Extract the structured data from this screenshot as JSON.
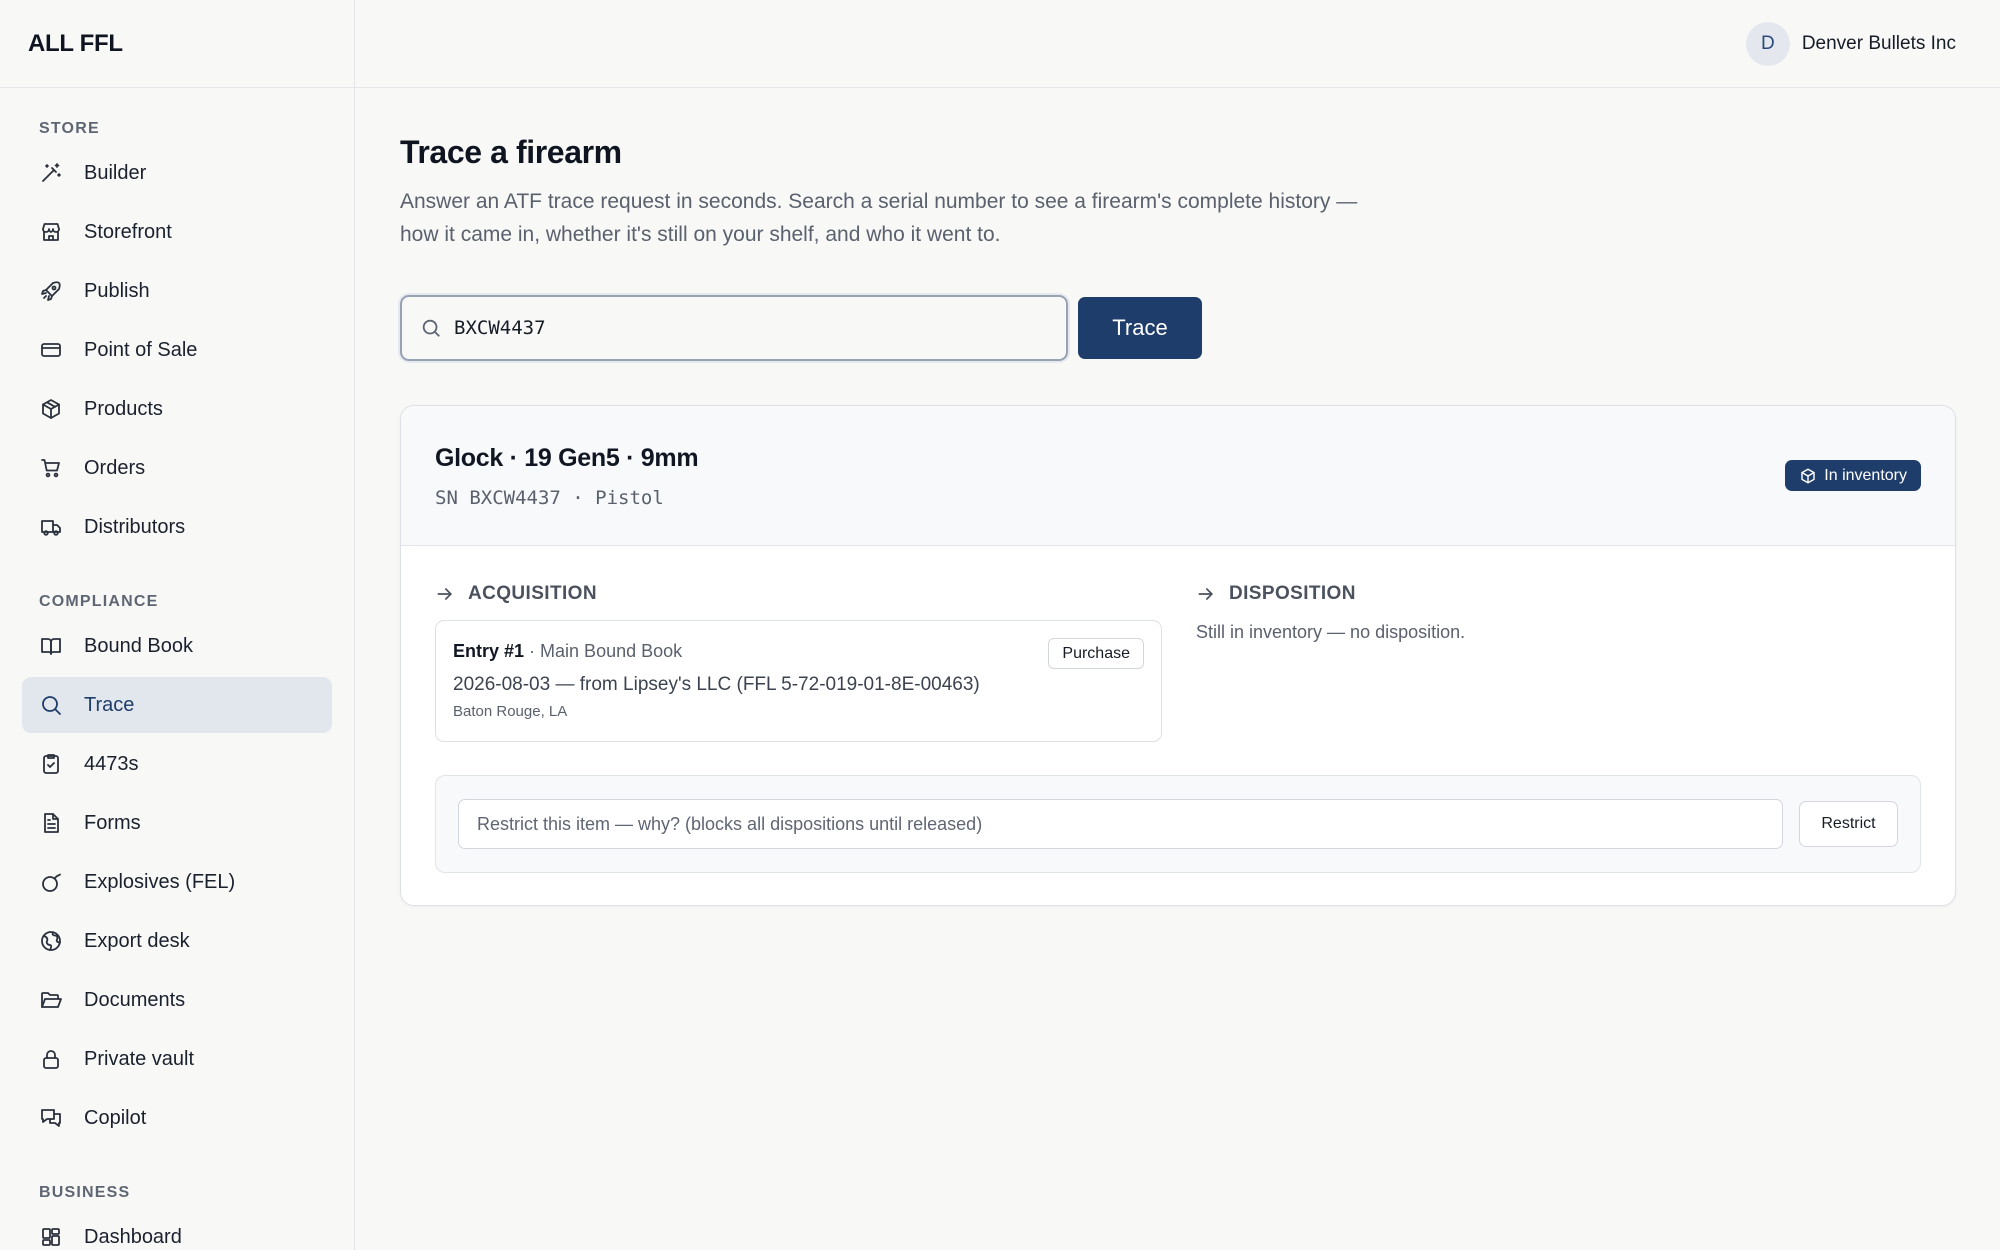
{
  "app": {
    "brand": "ALL FFL"
  },
  "account": {
    "initial": "D",
    "name": "Denver Bullets Inc"
  },
  "sidebar": {
    "sections": [
      {
        "label": "STORE",
        "items": [
          {
            "label": "Builder",
            "icon": "wand-icon"
          },
          {
            "label": "Storefront",
            "icon": "store-icon"
          },
          {
            "label": "Publish",
            "icon": "rocket-icon"
          },
          {
            "label": "Point of Sale",
            "icon": "credit-card-icon"
          },
          {
            "label": "Products",
            "icon": "package-icon"
          },
          {
            "label": "Orders",
            "icon": "cart-icon"
          },
          {
            "label": "Distributors",
            "icon": "truck-icon"
          }
        ]
      },
      {
        "label": "COMPLIANCE",
        "items": [
          {
            "label": "Bound Book",
            "icon": "book-open-icon"
          },
          {
            "label": "Trace",
            "icon": "search-icon",
            "active": true
          },
          {
            "label": "4473s",
            "icon": "clipboard-check-icon"
          },
          {
            "label": "Forms",
            "icon": "file-text-icon"
          },
          {
            "label": "Explosives (FEL)",
            "icon": "bomb-icon"
          },
          {
            "label": "Export desk",
            "icon": "globe-icon"
          },
          {
            "label": "Documents",
            "icon": "folder-open-icon"
          },
          {
            "label": "Private vault",
            "icon": "lock-icon"
          },
          {
            "label": "Copilot",
            "icon": "chat-icon"
          }
        ]
      },
      {
        "label": "BUSINESS",
        "items": [
          {
            "label": "Dashboard",
            "icon": "dashboard-icon"
          }
        ]
      }
    ]
  },
  "page": {
    "title": "Trace a firearm",
    "description": "Answer an ATF trace request in seconds. Search a serial number to see a firearm's complete history — how it came in, whether it's still on your shelf, and who it went to."
  },
  "search": {
    "value": "BXCW4437",
    "button_label": "Trace"
  },
  "result": {
    "title": "Glock · 19 Gen5 · 9mm",
    "subtitle": "SN BXCW4437 · Pistol",
    "status_badge": "In inventory",
    "acquisition": {
      "heading": "ACQUISITION",
      "entry_number": "Entry #1",
      "book": " · Main Bound Book",
      "type_badge": "Purchase",
      "detail": "2026-08-03 — from Lipsey's LLC (FFL 5-72-019-01-8E-00463)",
      "location": "Baton Rouge, LA"
    },
    "disposition": {
      "heading": "DISPOSITION",
      "text": "Still in inventory — no disposition."
    },
    "restrict": {
      "placeholder": "Restrict this item — why? (blocks all dispositions until released)",
      "button_label": "Restrict"
    }
  },
  "colors": {
    "accent": "#1f3d6a",
    "active_bg": "#e2e7ee",
    "background": "#f8f8f7"
  }
}
